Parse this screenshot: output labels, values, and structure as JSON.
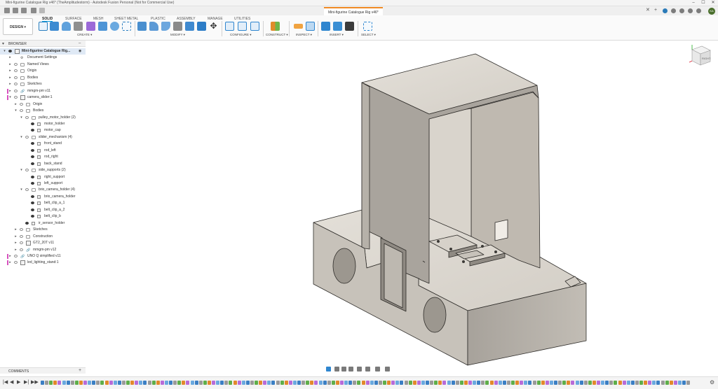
{
  "window": {
    "title": "Mini-figurine Catalogue Rig v46* (TheAmplitudestorm) - Autodesk Fusion Personal (Not for Commercial Use)",
    "controls": [
      "–",
      "☐",
      "✕"
    ]
  },
  "document_tab": {
    "name": "Mini-figurine Catalogue Rig v46*",
    "close": "✕",
    "new": "+"
  },
  "user": {
    "initials": "KA"
  },
  "workspace": {
    "label": "DESIGN",
    "caret": "▾"
  },
  "ribbon_tabs": [
    "SOLID",
    "SURFACE",
    "MESH",
    "SHEET METAL",
    "PLASTIC",
    "ASSEMBLY",
    "MANAGE",
    "UTILITIES"
  ],
  "active_tab": "SOLID",
  "tool_groups": [
    "CREATE ▾",
    "MODIFY ▾",
    "CONFIGURE ▾",
    "CONSTRUCT ▾",
    "INSPECT ▾",
    "INSERT ▾",
    "SELECT ▾"
  ],
  "browser": {
    "title": "BROWSER",
    "collapse": "–",
    "items": [
      {
        "label": "Mini-figurine Catalogue Rig...",
        "level": 0,
        "caret": "v",
        "type": "root"
      },
      {
        "label": "Document Settings",
        "level": 1,
        "caret": ">",
        "type": "gear"
      },
      {
        "label": "Named Views",
        "level": 1,
        "caret": ">",
        "type": "folder"
      },
      {
        "label": "Origin",
        "level": 1,
        "caret": ">",
        "type": "folder"
      },
      {
        "label": "Bodies",
        "level": 1,
        "caret": ">",
        "type": "folder"
      },
      {
        "label": "Sketches",
        "level": 1,
        "caret": ">",
        "type": "folder"
      },
      {
        "label": "mmgm-pm v11",
        "level": 1,
        "caret": ">",
        "type": "link"
      },
      {
        "label": "camera_slider:1",
        "level": 1,
        "caret": "v",
        "type": "comp"
      },
      {
        "label": "Origin",
        "level": 2,
        "caret": ">",
        "type": "folder"
      },
      {
        "label": "Bodies",
        "level": 2,
        "caret": "v",
        "type": "folder"
      },
      {
        "label": "pulley_motor_holder (2)",
        "level": 3,
        "caret": "v",
        "type": "folder"
      },
      {
        "label": "motor_holder",
        "level": 4,
        "caret": "",
        "type": "body"
      },
      {
        "label": "motor_cap",
        "level": 4,
        "caret": "",
        "type": "body"
      },
      {
        "label": "slider_mechanism (4)",
        "level": 3,
        "caret": "v",
        "type": "folder"
      },
      {
        "label": "front_stand",
        "level": 4,
        "caret": "",
        "type": "body"
      },
      {
        "label": "rod_left",
        "level": 4,
        "caret": "",
        "type": "body"
      },
      {
        "label": "rod_right",
        "level": 4,
        "caret": "",
        "type": "body"
      },
      {
        "label": "back_stand",
        "level": 4,
        "caret": "",
        "type": "body"
      },
      {
        "label": "side_supports (2)",
        "level": 3,
        "caret": "v",
        "type": "folder"
      },
      {
        "label": "right_support",
        "level": 4,
        "caret": "",
        "type": "body"
      },
      {
        "label": "left_support",
        "level": 4,
        "caret": "",
        "type": "body"
      },
      {
        "label": "brio_camera_holder (4)",
        "level": 3,
        "caret": "v",
        "type": "folder"
      },
      {
        "label": "brio_camera_holder",
        "level": 4,
        "caret": "",
        "type": "body"
      },
      {
        "label": "belt_clip_a_1",
        "level": 4,
        "caret": "",
        "type": "body"
      },
      {
        "label": "belt_clip_a_2",
        "level": 4,
        "caret": "",
        "type": "body"
      },
      {
        "label": "belt_clip_b",
        "level": 4,
        "caret": "",
        "type": "body"
      },
      {
        "label": "ir_sensor_holder",
        "level": 3,
        "caret": "",
        "type": "body"
      },
      {
        "label": "Sketches",
        "level": 2,
        "caret": ">",
        "type": "folder"
      },
      {
        "label": "Construction",
        "level": 2,
        "caret": ">",
        "type": "folder"
      },
      {
        "label": "GT2_20T v11",
        "level": 2,
        "caret": ">",
        "type": "comp"
      },
      {
        "label": "mmgm-pm v12",
        "level": 2,
        "caret": ">",
        "type": "link"
      },
      {
        "label": "UNO Q simplified v11",
        "level": 1,
        "caret": ">",
        "type": "link"
      },
      {
        "label": "led_lighting_stand:1",
        "level": 1,
        "caret": ">",
        "type": "comp"
      }
    ]
  },
  "comments": {
    "label": "COMMENTS",
    "add": "+"
  },
  "viewcube": {
    "face_label": "RIGHT"
  },
  "timeline": {
    "controls": [
      "|◀",
      "◀",
      "▶",
      "▶|",
      "▶▶"
    ]
  },
  "colors": {
    "accent": "#0696d7",
    "tab_accent": "#f08a24",
    "model_top": "#e0dcd5",
    "model_side": "#a9a49d",
    "model_front": "#c9c4bc",
    "edge": "#2d2b28"
  }
}
